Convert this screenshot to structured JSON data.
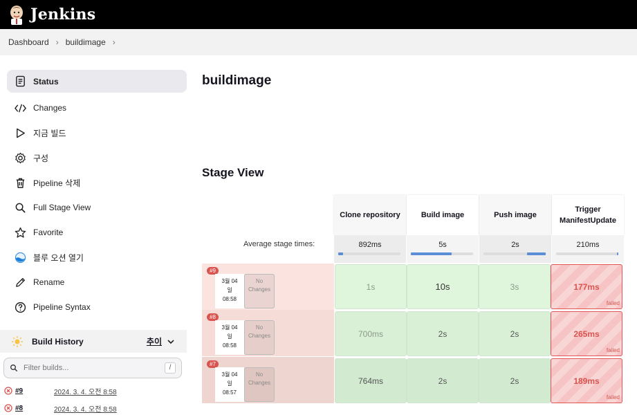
{
  "header": {
    "brand": "Jenkins"
  },
  "breadcrumb": {
    "items": [
      "Dashboard",
      "buildimage"
    ]
  },
  "sidebar": {
    "items": [
      {
        "label": "Status",
        "icon": "status-icon"
      },
      {
        "label": "Changes",
        "icon": "code-icon"
      },
      {
        "label": "지금 빌드",
        "icon": "play-icon"
      },
      {
        "label": "구성",
        "icon": "gear-icon"
      },
      {
        "label": "Pipeline 삭제",
        "icon": "trash-icon"
      },
      {
        "label": "Full Stage View",
        "icon": "search-icon"
      },
      {
        "label": "Favorite",
        "icon": "star-icon"
      },
      {
        "label": "블루 오션 열기",
        "icon": "blue-ocean-icon"
      },
      {
        "label": "Rename",
        "icon": "pencil-icon"
      },
      {
        "label": "Pipeline Syntax",
        "icon": "help-icon"
      }
    ]
  },
  "build_history": {
    "title": "Build History",
    "trend_label": "추이",
    "filter_placeholder": "Filter builds...",
    "filter_shortcut": "/",
    "rows": [
      {
        "num": "#9",
        "date": "2024. 3. 4. 오전 8:58"
      },
      {
        "num": "#8",
        "date": "2024. 3. 4. 오전 8:58"
      }
    ]
  },
  "main": {
    "title": "buildimage",
    "stage_view_title": "Stage View"
  },
  "stage_view": {
    "avg_label": "Average stage times:",
    "stages": [
      "Clone repository",
      "Build image",
      "Push image",
      "Trigger ManifestUpdate"
    ],
    "avg_times": [
      "892ms",
      "5s",
      "2s",
      "210ms"
    ],
    "avg_fill": [
      0.08,
      0.65,
      0.3,
      0.02
    ],
    "builds": [
      {
        "num": "#9",
        "date": "3월 04",
        "day": "일",
        "time": "08:58",
        "changes": "No Changes",
        "cells": [
          "1s",
          "10s",
          "3s",
          "177ms"
        ],
        "status": [
          "ok-faint",
          "ok",
          "ok-faint",
          "fail"
        ]
      },
      {
        "num": "#8",
        "date": "3월 04",
        "day": "일",
        "time": "08:58",
        "changes": "No Changes",
        "cells": [
          "700ms",
          "2s",
          "2s",
          "265ms"
        ],
        "status": [
          "ok-faint",
          "ok",
          "ok",
          "fail"
        ]
      },
      {
        "num": "#7",
        "date": "3월 04",
        "day": "일",
        "time": "08:57",
        "changes": "No Changes",
        "cells": [
          "764ms",
          "2s",
          "2s",
          "189ms"
        ],
        "status": [
          "ok-faint",
          "ok",
          "ok",
          "fail"
        ]
      }
    ],
    "failed_label": "failed"
  },
  "colors": {
    "header_bg": "#000000",
    "fail": "#d9534f",
    "success_cell": "#dff5dc",
    "bar": "#5b8ed6"
  }
}
